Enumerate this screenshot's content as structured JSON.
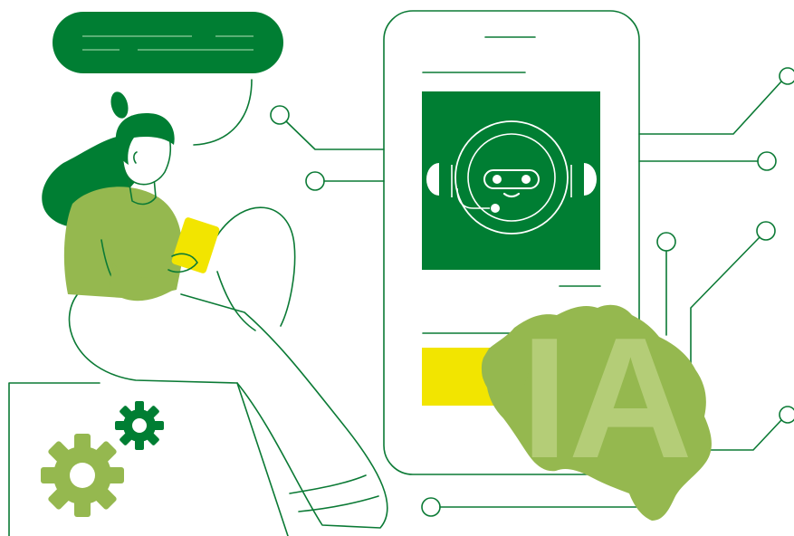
{
  "illustration": {
    "badge_text": "IA",
    "colors": {
      "dark_green": "#007e33",
      "light_green": "#95b84f",
      "yellow": "#f2e500",
      "outline": "#0b7a35",
      "background": "#ffffff"
    },
    "icons": [
      "chat-bubble-icon",
      "robot-icon",
      "gear-icon",
      "smartphone-icon",
      "map-icon"
    ]
  }
}
